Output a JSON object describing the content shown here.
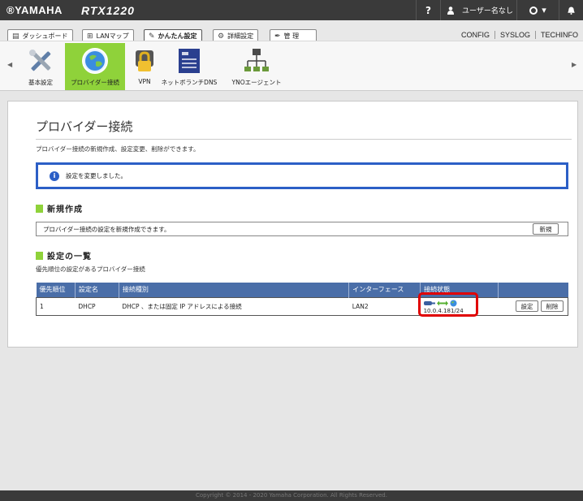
{
  "header": {
    "brand": "®YAMAHA",
    "model": "RTX1220",
    "help": "?",
    "user": "ユーザー名なし"
  },
  "menu": {
    "items": [
      {
        "label": "ダッシュボード"
      },
      {
        "label": "LANマップ"
      },
      {
        "label": "かんたん設定"
      },
      {
        "label": "詳細設定"
      },
      {
        "label": "管 理"
      }
    ],
    "links": [
      "CONFIG",
      "SYSLOG",
      "TECHINFO"
    ]
  },
  "icons": [
    {
      "label": "基本設定"
    },
    {
      "label": "プロバイダー接続"
    },
    {
      "label": "VPN"
    },
    {
      "label": "ネットボランチDNS"
    },
    {
      "label": "YNOエージェント"
    }
  ],
  "page": {
    "title": "プロバイダー接続",
    "description": "プロバイダー接続の新規作成、設定変更、削除ができます。",
    "notice": "設定を変更しました。"
  },
  "new_section": {
    "heading": "新規作成",
    "text": "プロバイダー接続の設定を新規作成できます。",
    "button": "新規"
  },
  "list_section": {
    "heading": "設定の一覧",
    "subtitle": "優先順位の設定があるプロバイダー接続",
    "columns": [
      "優先順位",
      "設定名",
      "接続種別",
      "インターフェース",
      "接続状態",
      ""
    ],
    "rows": [
      {
        "priority": "1",
        "name": "DHCP",
        "type": "DHCP 、または固定 IP アドレスによる接続",
        "interface": "LAN2",
        "ip": "10.0.4.181/24",
        "edit": "設定",
        "delete": "削除"
      }
    ]
  },
  "footer": "Copyright © 2014 - 2020 Yamaha Corporation. All Rights Reserved.",
  "colors": {
    "topbar": "#3a3a3a",
    "accent_green": "#8fd23a",
    "notice_blue": "#2c5fc6",
    "table_header": "#4a6ea8",
    "highlight_red": "#e00000"
  }
}
